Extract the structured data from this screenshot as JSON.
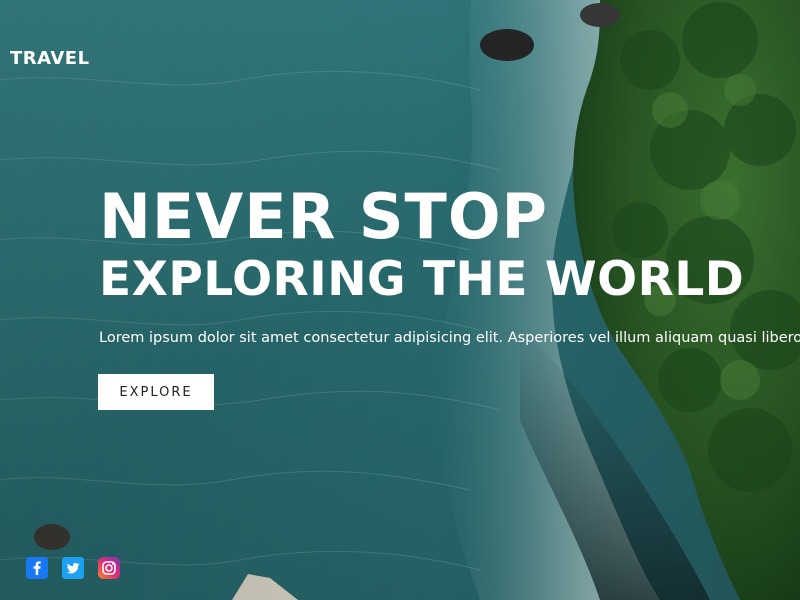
{
  "brand": {
    "label": "TRAVEL"
  },
  "hero": {
    "title_line1": "NEVER STOP",
    "title_line2": "EXPLORING THE WORLD",
    "lead": "Lorem ipsum dolor sit amet consectetur adipisicing elit. Asperiores vel illum aliquam quasi libero",
    "cta_label": "EXPLORE"
  },
  "social": {
    "icons": [
      "facebook-icon",
      "twitter-icon",
      "instagram-icon"
    ]
  },
  "colors": {
    "text": "#ffffff",
    "button_bg": "#ffffff",
    "button_text": "#222222",
    "water": "#2b6f72",
    "forest": "#1f4b24"
  }
}
